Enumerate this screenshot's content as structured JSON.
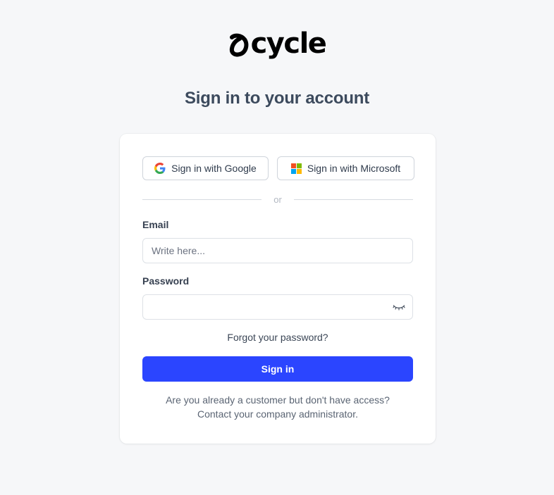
{
  "brand": {
    "name": "cycle",
    "logo_icon": "cycle-logo-mark"
  },
  "page": {
    "title": "Sign in to your account"
  },
  "sso": {
    "google_label": "Sign in with Google",
    "google_icon": "google-icon",
    "microsoft_label": "Sign in with Microsoft",
    "microsoft_icon": "microsoft-icon"
  },
  "divider": {
    "text": "or"
  },
  "form": {
    "email_label": "Email",
    "email_placeholder": "Write here...",
    "email_value": "",
    "password_label": "Password",
    "password_value": "",
    "password_toggle_icon": "eye-closed-icon",
    "forgot_label": "Forgot your password?",
    "submit_label": "Sign in"
  },
  "footer": {
    "line1": "Are you already a customer but don't have access?",
    "line2": "Contact your company administrator."
  },
  "colors": {
    "background": "#f6f7f9",
    "primary": "#2b45ff",
    "title": "#3c4a5d"
  }
}
